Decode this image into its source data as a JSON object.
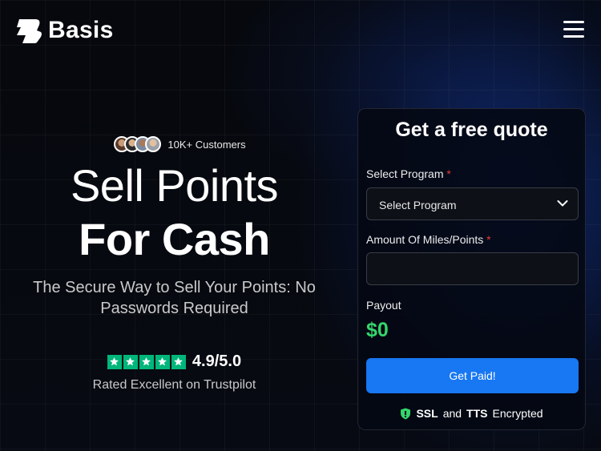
{
  "brand": {
    "name": "Basis"
  },
  "hero": {
    "customers": "10K+ Customers",
    "title_line1": "Sell Points",
    "title_line2": "For Cash",
    "subtitle": "The Secure Way to Sell Your Points: No Passwords Required",
    "rating_score": "4.9/5.0",
    "rating_text": "Rated Excellent on Trustpilot",
    "rating_stars": 5
  },
  "quote_form": {
    "title": "Get a free quote",
    "program_label": "Select Program",
    "program_selected": "Select Program",
    "amount_label": "Amount Of Miles/Points",
    "amount_value": "",
    "required_mark": "*",
    "payout_label": "Payout",
    "payout_value": "$0",
    "submit_label": "Get Paid!",
    "security": {
      "ssl": "SSL",
      "and": "and",
      "tts": "TTS",
      "encrypted": "Encrypted"
    }
  },
  "icons": {
    "logo": "basis-logo-icon",
    "menu": "hamburger-menu-icon",
    "star": "star-icon",
    "chevron": "chevron-down-icon",
    "shield": "shield-icon"
  },
  "colors": {
    "accent": "#1877f2",
    "payout": "#34d46c",
    "trustpilot": "#00b67a",
    "required": "#e53935"
  }
}
